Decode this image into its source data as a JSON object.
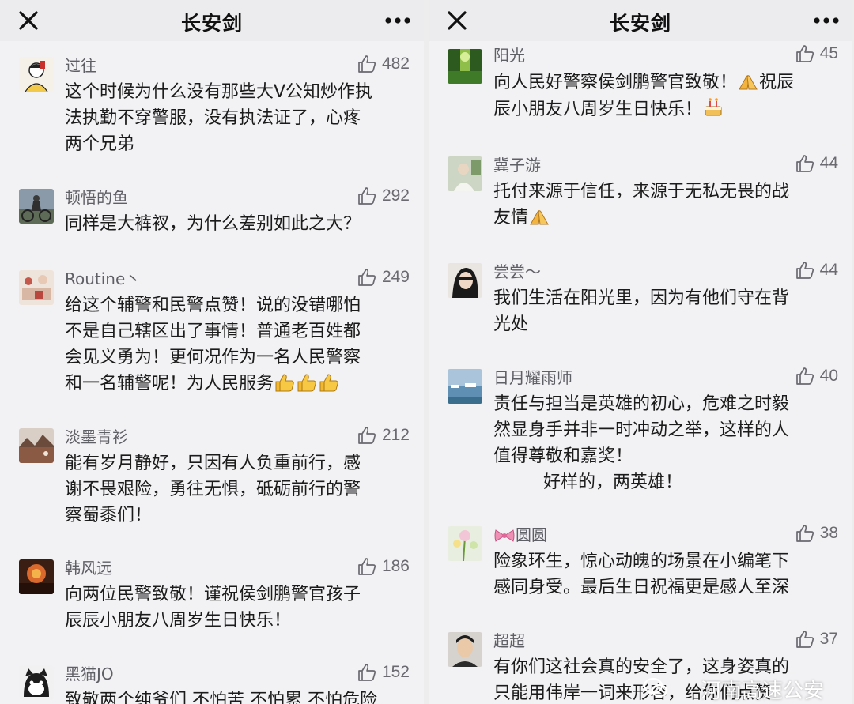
{
  "left": {
    "title": "长安剑",
    "comments": [
      {
        "name": "过往",
        "likes": "482",
        "text": "这个时候为什么没有那些大V公知炒作执\n法执勤不穿警服，没有执法证了，心疼\n两个兄弟"
      },
      {
        "name": "顿悟的鱼",
        "likes": "292",
        "text": "同样是大裤衩，为什么差别如此之大？"
      },
      {
        "name": "Routine丶",
        "likes": "249",
        "text": "给这个辅警和民警点赞！说的没错哪怕\n不是自己辖区出了事情！普通老百姓都\n会见义勇为！更何况作为一名人民警察\n和一名辅警呢！为人民服务"
      },
      {
        "name": "淡墨青衫",
        "likes": "212",
        "text": "能有岁月静好，只因有人负重前行，感\n谢不畏艰险，勇往无惧，砥砺前行的警\n察蜀黍们！"
      },
      {
        "name": "韩风远",
        "likes": "186",
        "text": "向两位民警致敬！谨祝侯剑鹏警官孩子\n辰辰小朋友八周岁生日快乐！"
      },
      {
        "name": "黑猫JO",
        "likes": "152",
        "text": "致敬两个纯爷们 不怕苦 不怕累 不怕危险"
      }
    ]
  },
  "right": {
    "title": "长安剑",
    "comments": [
      {
        "name": "阳光",
        "likes": "45",
        "text": "向人民好警察侯剑鹏警官致敬！",
        "text2": "祝辰",
        "text3": "辰小朋友八周岁生日快乐！"
      },
      {
        "name": "冀子游",
        "likes": "44",
        "text": "托付来源于信任，来源于无私无畏的战\n友情"
      },
      {
        "name": "尝尝～",
        "likes": "44",
        "text": "我们生活在阳光里，因为有他们守在背\n光处"
      },
      {
        "name": "日月耀雨师",
        "likes": "40",
        "text": "责任与担当是英雄的初心，危难之时毅\n然显身手并非一时冲动之举，这样的人\n值得尊敬和嘉奖！\n         好样的，两英雄！"
      },
      {
        "name": "圆圆",
        "likes": "38",
        "text": "险象环生，惊心动魄的场景在小编笔下\n感同身受。最后生日祝福更是感人至深"
      },
      {
        "name": "超超",
        "likes": "37",
        "text": "有你们这社会真的安全了，这身姿真的\n只能用伟岸一词来形容，给你们点赞"
      }
    ]
  },
  "watermark": "河南高速公安",
  "colors": {
    "background": "#f2f2f4",
    "topbar": "#ececee",
    "nickname": "#5f5f66",
    "text": "#1b1b1b"
  },
  "icons": {
    "close": "close-icon",
    "more": "more-icon",
    "like": "thumbs-up-outline-icon",
    "thumbs_emoji": "thumbs-up-emoji",
    "pray_emoji": "pray-hands-emoji",
    "cake_emoji": "birthday-cake-emoji",
    "bow_emoji": "ribbon-bow-emoji"
  }
}
